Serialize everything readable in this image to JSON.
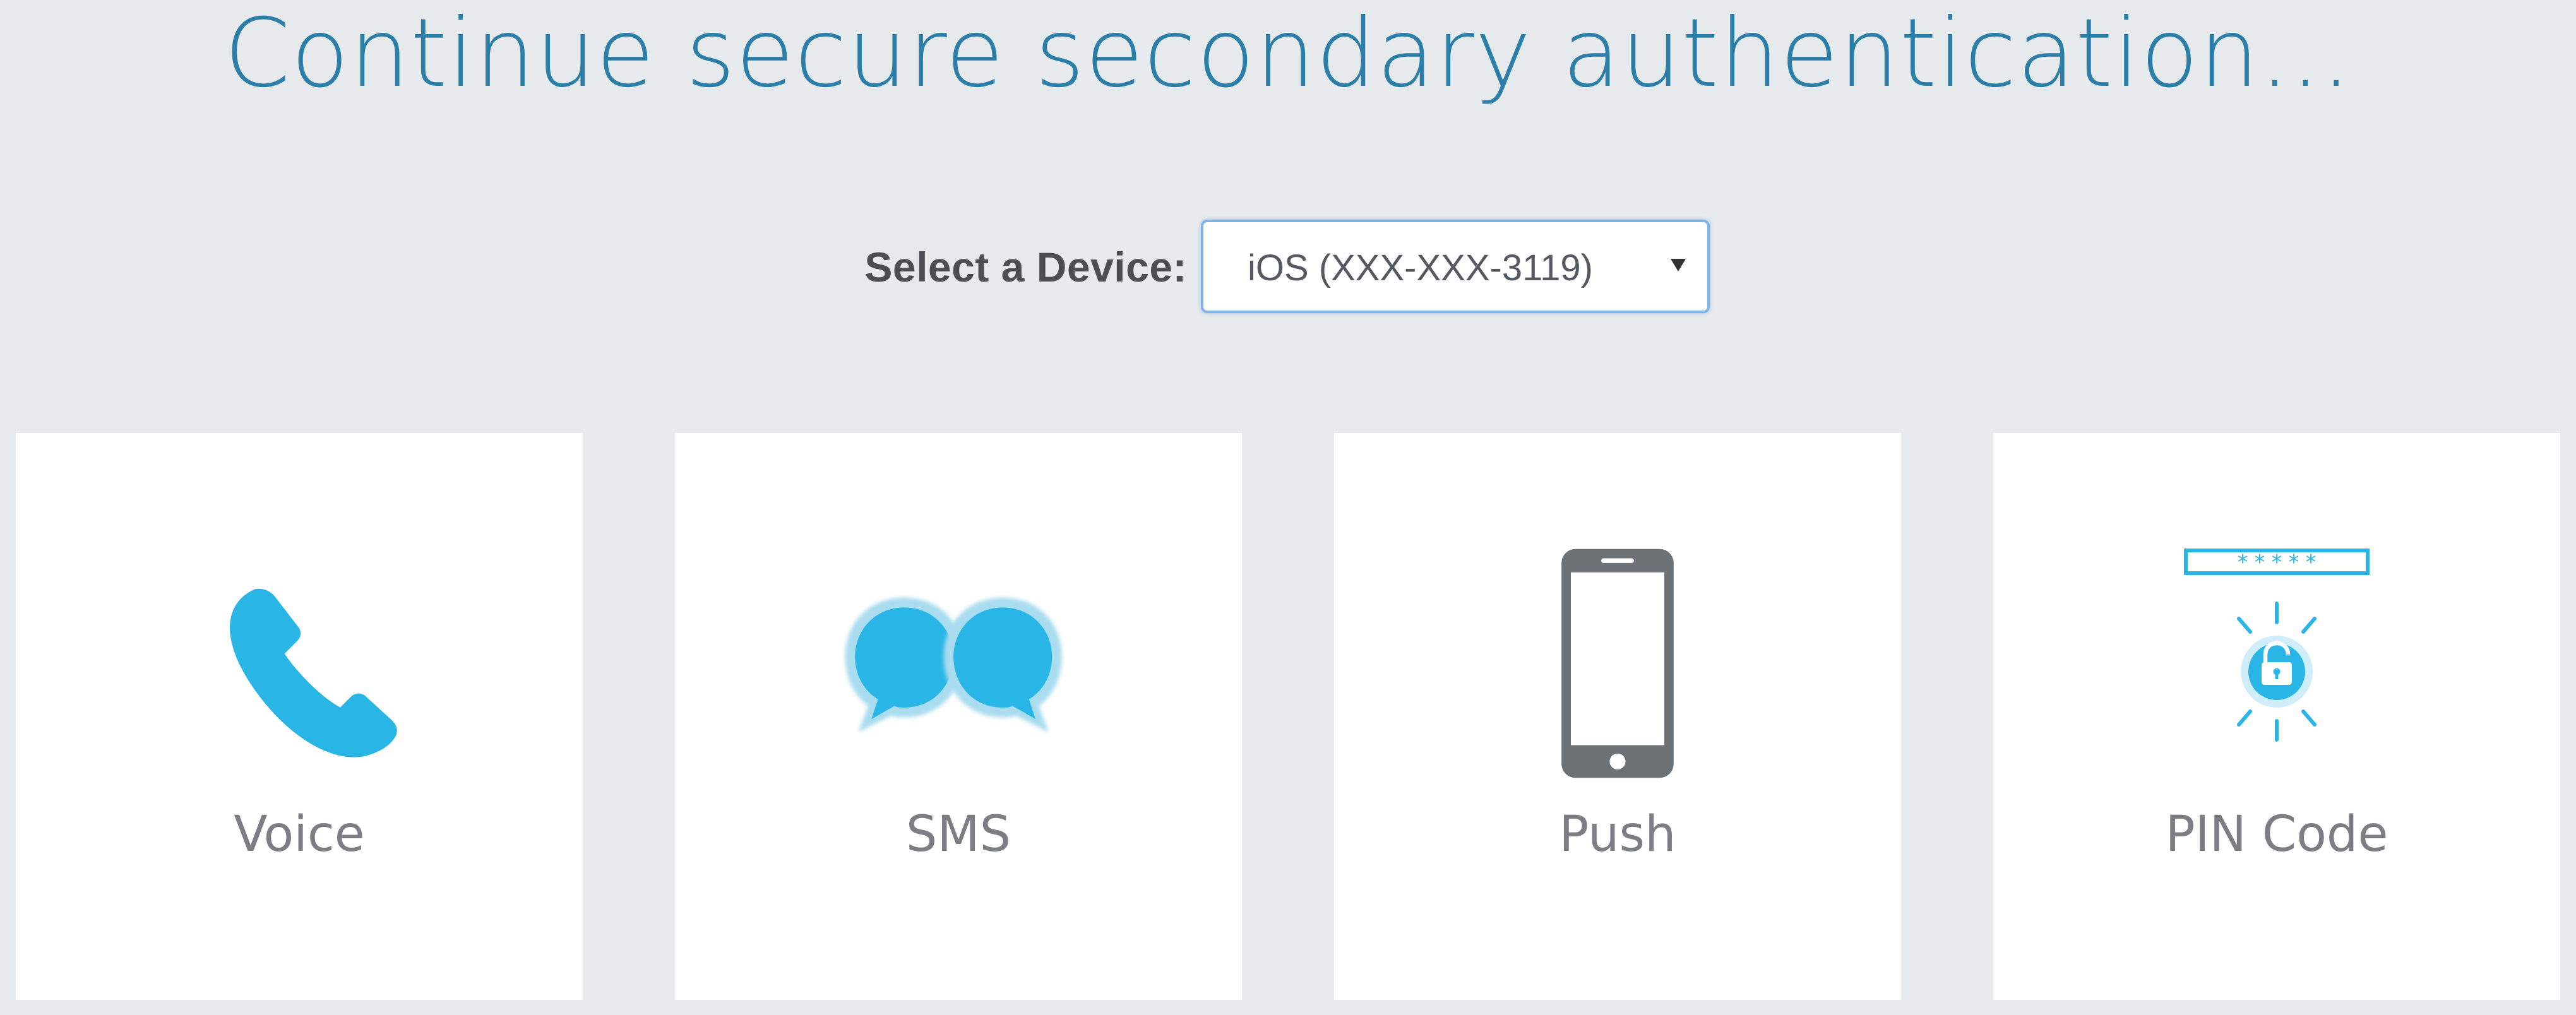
{
  "page": {
    "title": "Continue secure secondary authentication..."
  },
  "device": {
    "label": "Select a Device:",
    "selected": "iOS (XXX-XXX-3119)"
  },
  "methods": [
    {
      "label": "Voice",
      "icon": "phone-icon"
    },
    {
      "label": "SMS",
      "icon": "chat-bubbles-icon"
    },
    {
      "label": "Push",
      "icon": "smartphone-icon"
    },
    {
      "label": "PIN Code",
      "icon": "pin-unlock-icon"
    }
  ],
  "colors": {
    "accent": "#2b7ea8",
    "icon_blue": "#29b6e6",
    "icon_gray": "#6d7276",
    "background": "#e7eaed"
  }
}
